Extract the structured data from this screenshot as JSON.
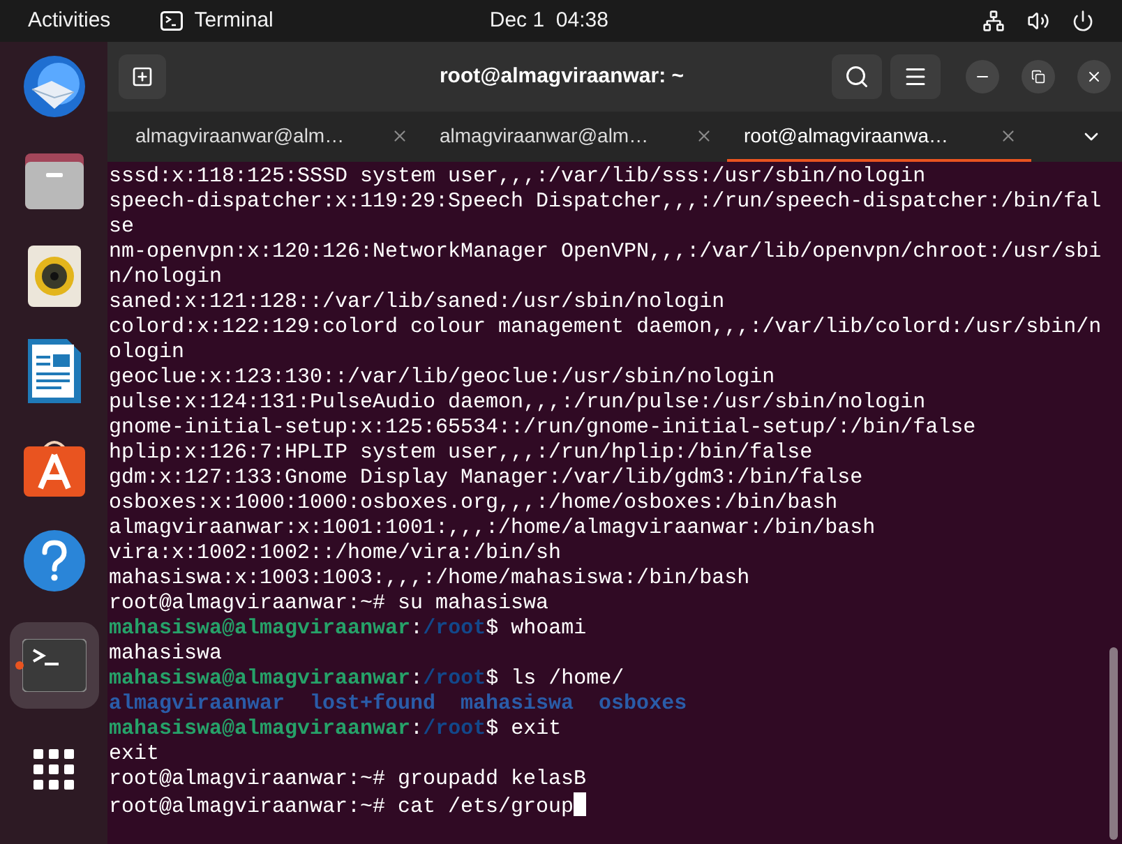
{
  "top_bar": {
    "activities": "Activities",
    "app_name": "Terminal",
    "clock": "Dec 1  04:38"
  },
  "dock": {
    "items": [
      {
        "kind": "mail",
        "selected": false
      },
      {
        "kind": "files",
        "selected": false
      },
      {
        "kind": "music",
        "selected": false
      },
      {
        "kind": "writer",
        "selected": false
      },
      {
        "kind": "store",
        "selected": false
      },
      {
        "kind": "help",
        "selected": false
      },
      {
        "kind": "terminal",
        "selected": true
      },
      {
        "kind": "grid",
        "selected": false
      }
    ]
  },
  "window": {
    "title": "root@almagviraanwar: ~"
  },
  "tabs": [
    {
      "label": "almagviraanwar@alm…",
      "selected": false
    },
    {
      "label": "almagviraanwar@alm…",
      "selected": false
    },
    {
      "label": "root@almagviraanwa…",
      "selected": true
    }
  ],
  "terminal": {
    "cursor": true,
    "lines": [
      [
        {
          "kind": "plain",
          "text": "sssd:x:118:125:SSSD system user,,,:/var/lib/sss:/usr/sbin/nologin"
        }
      ],
      [
        {
          "kind": "plain",
          "text": "speech-dispatcher:x:119:29:Speech Dispatcher,,,:/run/speech-dispatcher:/bin/false"
        }
      ],
      [
        {
          "kind": "plain",
          "text": "nm-openvpn:x:120:126:NetworkManager OpenVPN,,,:/var/lib/openvpn/chroot:/usr/sbin/nologin"
        }
      ],
      [
        {
          "kind": "plain",
          "text": "saned:x:121:128::/var/lib/saned:/usr/sbin/nologin"
        }
      ],
      [
        {
          "kind": "plain",
          "text": "colord:x:122:129:colord colour management daemon,,,:/var/lib/colord:/usr/sbin/nologin"
        }
      ],
      [
        {
          "kind": "plain",
          "text": "geoclue:x:123:130::/var/lib/geoclue:/usr/sbin/nologin"
        }
      ],
      [
        {
          "kind": "plain",
          "text": "pulse:x:124:131:PulseAudio daemon,,,:/run/pulse:/usr/sbin/nologin"
        }
      ],
      [
        {
          "kind": "plain",
          "text": "gnome-initial-setup:x:125:65534::/run/gnome-initial-setup/:/bin/false"
        }
      ],
      [
        {
          "kind": "plain",
          "text": "hplip:x:126:7:HPLIP system user,,,:/run/hplip:/bin/false"
        }
      ],
      [
        {
          "kind": "plain",
          "text": "gdm:x:127:133:Gnome Display Manager:/var/lib/gdm3:/bin/false"
        }
      ],
      [
        {
          "kind": "plain",
          "text": "osboxes:x:1000:1000:osboxes.org,,,:/home/osboxes:/bin/bash"
        }
      ],
      [
        {
          "kind": "plain",
          "text": "almagviraanwar:x:1001:1001:,,,:/home/almagviraanwar:/bin/bash"
        }
      ],
      [
        {
          "kind": "plain",
          "text": "vira:x:1002:1002::/home/vira:/bin/sh"
        }
      ],
      [
        {
          "kind": "plain",
          "text": "mahasiswa:x:1003:1003:,,,:/home/mahasiswa:/bin/bash"
        }
      ],
      [
        {
          "kind": "plain",
          "text": "root@almagviraanwar:~# su mahasiswa"
        }
      ],
      [
        {
          "kind": "user",
          "text": "mahasiswa@almagviraanwar"
        },
        {
          "kind": "plain",
          "text": ":"
        },
        {
          "kind": "path",
          "text": "/root"
        },
        {
          "kind": "plain",
          "text": "$ whoami"
        }
      ],
      [
        {
          "kind": "plain",
          "text": "mahasiswa"
        }
      ],
      [
        {
          "kind": "user",
          "text": "mahasiswa@almagviraanwar"
        },
        {
          "kind": "plain",
          "text": ":"
        },
        {
          "kind": "path",
          "text": "/root"
        },
        {
          "kind": "plain",
          "text": "$ ls /home/"
        }
      ],
      [
        {
          "kind": "dir",
          "text": "almagviraanwar  lost+found  mahasiswa  osboxes"
        }
      ],
      [
        {
          "kind": "user",
          "text": "mahasiswa@almagviraanwar"
        },
        {
          "kind": "plain",
          "text": ":"
        },
        {
          "kind": "path",
          "text": "/root"
        },
        {
          "kind": "plain",
          "text": "$ exit"
        }
      ],
      [
        {
          "kind": "plain",
          "text": "exit"
        }
      ],
      [
        {
          "kind": "plain",
          "text": "root@almagviraanwar:~# groupadd kelasB"
        }
      ],
      [
        {
          "kind": "plain",
          "text": "root@almagviraanwar:~# cat /ets/group"
        }
      ]
    ]
  }
}
